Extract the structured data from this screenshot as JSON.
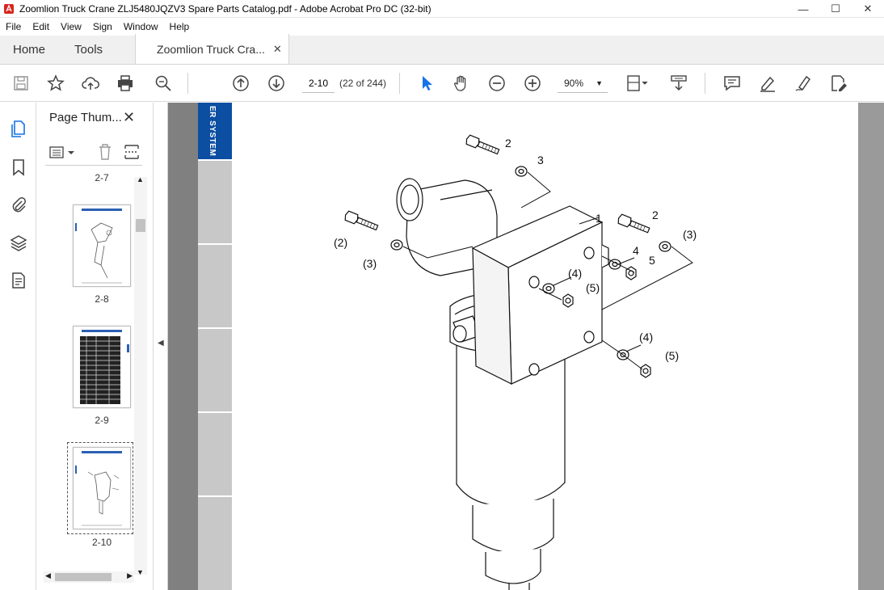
{
  "window": {
    "title": "Zoomlion Truck Crane ZLJ5480JQZV3 Spare Parts Catalog.pdf - Adobe Acrobat Pro DC (32-bit)",
    "minimize": "—",
    "maximize": "☐",
    "close": "✕"
  },
  "menu": {
    "items": [
      "File",
      "Edit",
      "View",
      "Sign",
      "Window",
      "Help"
    ]
  },
  "tabs": {
    "home": "Home",
    "tools": "Tools",
    "doc": "Zoomlion Truck Cra...",
    "doc_close": "✕"
  },
  "toolbar": {
    "page_value": "2-10",
    "page_count": "(22 of 244)",
    "zoom_value": "90%"
  },
  "thumbnails": {
    "title": "Page Thum...",
    "close": "✕",
    "pages": [
      {
        "label": "2-7"
      },
      {
        "label": "2-8"
      },
      {
        "label": "2-9"
      },
      {
        "label": "2-10"
      }
    ]
  },
  "document": {
    "section_label": "ER SYSTEM",
    "callouts": {
      "c1": "1",
      "c2a": "2",
      "c3a": "3",
      "c2b": "(2)",
      "c3b": "(3)",
      "c2c": "2",
      "c3c": "(3)",
      "c4a": "4",
      "c5a": "5",
      "c4b": "(4)",
      "c5b": "(5)",
      "c4c": "(4)",
      "c5c": "(5)"
    }
  },
  "colors": {
    "accent": "#0b4ea2",
    "doc_bg": "#808080",
    "cursor_blue": "#1473e6"
  }
}
